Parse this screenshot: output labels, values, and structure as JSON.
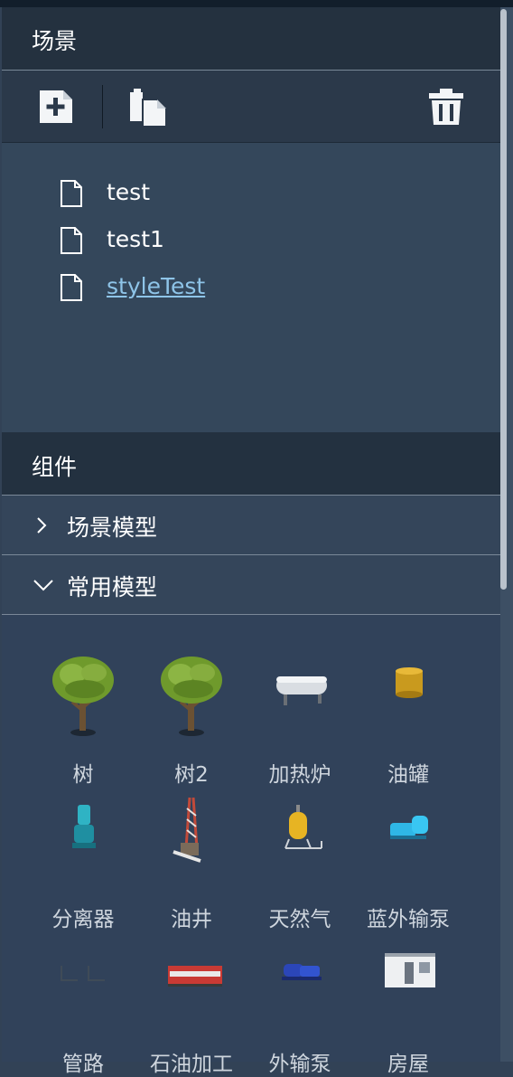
{
  "scene": {
    "title": "场景",
    "files": [
      {
        "name": "test"
      },
      {
        "name": "test1"
      },
      {
        "name": "styleTest"
      }
    ],
    "toolbar": {
      "add_icon": "file-add-icon",
      "copy_icon": "copy-icon",
      "delete_icon": "trash-icon"
    }
  },
  "components": {
    "title": "组件",
    "groups": [
      {
        "label": "场景模型",
        "expanded": false
      },
      {
        "label": "常用模型",
        "expanded": true
      }
    ],
    "models": [
      {
        "label": "树",
        "icon": "tree-icon"
      },
      {
        "label": "树2",
        "icon": "tree-icon"
      },
      {
        "label": "加热炉",
        "icon": "heater-icon"
      },
      {
        "label": "油罐",
        "icon": "oil-tank-icon"
      },
      {
        "label": "分离器",
        "icon": "separator-icon"
      },
      {
        "label": "油井",
        "icon": "oil-well-icon"
      },
      {
        "label": "天然气",
        "icon": "gas-tank-icon"
      },
      {
        "label": "蓝外输泵",
        "icon": "blue-pump-icon"
      },
      {
        "label": "管路",
        "icon": "pipeline-icon"
      },
      {
        "label": "石油加工",
        "icon": "oil-processing-icon"
      },
      {
        "label": "外输泵",
        "icon": "export-pump-icon"
      },
      {
        "label": "房屋",
        "icon": "house-icon"
      }
    ]
  },
  "colors": {
    "panel_bg": "#324256",
    "header_bg": "#24313f",
    "active_link": "#8ec4e8"
  }
}
